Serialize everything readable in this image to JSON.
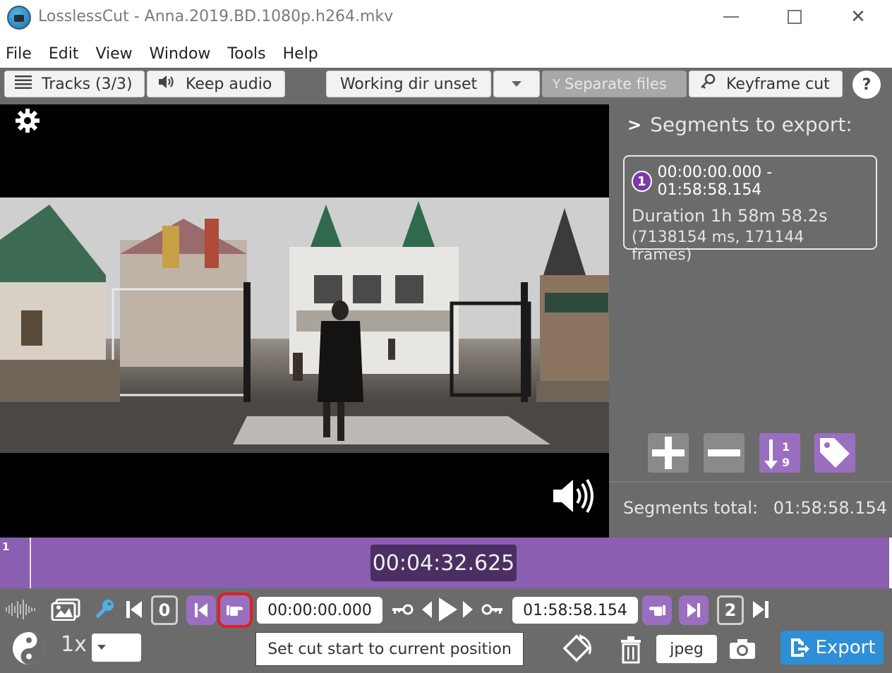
{
  "window": {
    "title": "LosslessCut - Anna.2019.BD.1080p.h264.mkv",
    "minimize_glyph": "",
    "close_glyph": "✕"
  },
  "menu": {
    "items": [
      "File",
      "Edit",
      "View",
      "Window",
      "Tools",
      "Help"
    ]
  },
  "toolbar": {
    "tracks_label": "Tracks (3/3)",
    "audio_label": "Keep audio",
    "working_dir_label": "Working dir unset",
    "separate_files_label": "Separate files",
    "keyframe_cut_label": "Keyframe cut",
    "help_label": "?"
  },
  "segments": {
    "header": "Segments to export:",
    "items": [
      {
        "number": "1",
        "range": "00:00:00.000 - 01:58:58.154",
        "duration": "Duration 1h 58m 58.2s",
        "detail": "(7138154 ms, 171144 frames)"
      }
    ],
    "total_label": "Segments total:",
    "total_value": "01:58:58.154"
  },
  "timeline": {
    "segment_label": "1",
    "current_time": "00:04:32.625",
    "colors": {
      "segment": "#8a5eb0",
      "badge": "#4b2f62"
    }
  },
  "controls": {
    "start_segment_index": "0",
    "end_segment_index": "2",
    "cut_start_time": "00:00:00.000",
    "cut_end_time": "01:58:58.154",
    "playback_speed": "1x",
    "tooltip": "Set cut start to current position",
    "capture_format": "jpeg",
    "export_label": "Export"
  },
  "icons": {
    "app": "losslesscut-app-icon",
    "settings": "gear-icon",
    "volume": "volume-icon",
    "waveform": "waveform-icon",
    "thumbnails": "images-icon",
    "keyframes": "key-icon"
  },
  "colors": {
    "accent_purple": "#9b6fc0",
    "panel_gray": "#6b6b6b",
    "export_blue": "#2f8fd6",
    "highlight_red": "#e02020"
  }
}
